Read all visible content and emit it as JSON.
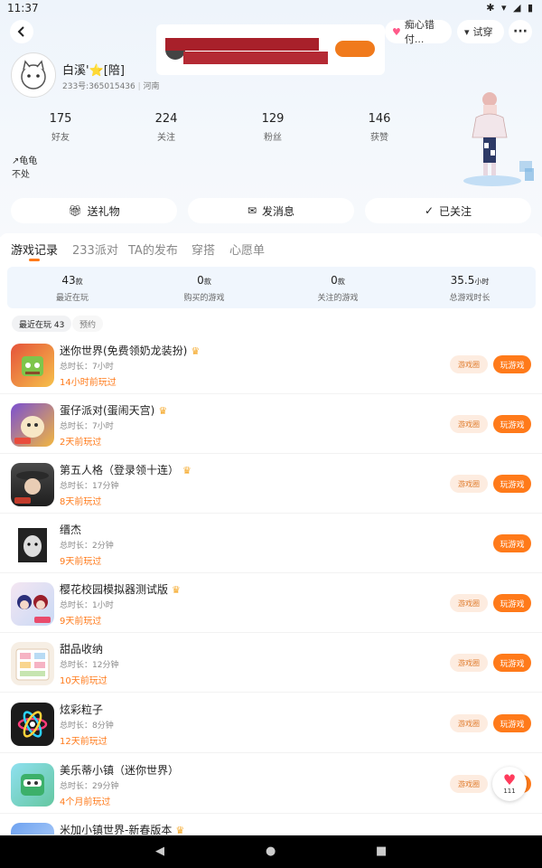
{
  "status_bar": {
    "time": "11:37",
    "icons": "✱ ▾ ◢ ▮"
  },
  "header": {
    "gift_pill": "痴心错付...",
    "tryon_pill": "试穿",
    "username": "白溪'⭐[陪]",
    "userid": "233号:365015436",
    "location": "河南"
  },
  "stats": [
    {
      "value": "175",
      "label": "好友"
    },
    {
      "value": "224",
      "label": "关注"
    },
    {
      "value": "129",
      "label": "粉丝"
    },
    {
      "value": "146",
      "label": "获赞"
    }
  ],
  "bio": {
    "line1": "↗龟龟",
    "line2": "不处"
  },
  "actions": {
    "gift": "送礼物",
    "message": "发消息",
    "followed": "已关注"
  },
  "tabs": [
    "游戏记录",
    "233派对",
    "TA的发布",
    "穿搭",
    "心愿单"
  ],
  "summary": [
    {
      "value": "43",
      "unit": "款",
      "label": "最近在玩"
    },
    {
      "value": "0",
      "unit": "款",
      "label": "购买的游戏"
    },
    {
      "value": "0",
      "unit": "款",
      "label": "关注的游戏"
    },
    {
      "value": "35.5",
      "unit": "小时",
      "label": "总游戏时长"
    }
  ],
  "chips": {
    "recent": "最近在玩 43",
    "reserve": "预约"
  },
  "buttons": {
    "circle": "游戏圈",
    "play": "玩游戏"
  },
  "games": [
    {
      "name": "迷你世界(免费领奶龙装扮)",
      "duration": "总时长：7小时",
      "last": "14小时前玩过",
      "crown": true,
      "circle": true
    },
    {
      "name": "蛋仔派对(蛋闹天宫)",
      "duration": "总时长：7小时",
      "last": "2天前玩过",
      "crown": true,
      "circle": true
    },
    {
      "name": "第五人格（登录领十连）",
      "duration": "总时长：17分钟",
      "last": "8天前玩过",
      "crown": true,
      "circle": true
    },
    {
      "name": "缙杰",
      "duration": "总时长：2分钟",
      "last": "9天前玩过",
      "crown": false,
      "circle": false
    },
    {
      "name": "樱花校园模拟器测试版",
      "duration": "总时长：1小时",
      "last": "9天前玩过",
      "crown": true,
      "circle": true
    },
    {
      "name": "甜品收纳",
      "duration": "总时长：12分钟",
      "last": "10天前玩过",
      "crown": false,
      "circle": true
    },
    {
      "name": "炫彩粒子",
      "duration": "总时长：8分钟",
      "last": "12天前玩过",
      "crown": false,
      "circle": true
    },
    {
      "name": "美乐蒂小镇（迷你世界）",
      "duration": "总时长：29分钟",
      "last": "4个月前玩过",
      "crown": false,
      "circle": true
    },
    {
      "name": "米加小镇世界-新春版本",
      "duration": "",
      "last": "",
      "crown": true,
      "circle": true
    }
  ],
  "float_like": {
    "count": "111"
  },
  "colors": {
    "accent": "#ff7a1a",
    "accent_light": "#fdece0",
    "summary_bg": "#f0f6fd"
  }
}
